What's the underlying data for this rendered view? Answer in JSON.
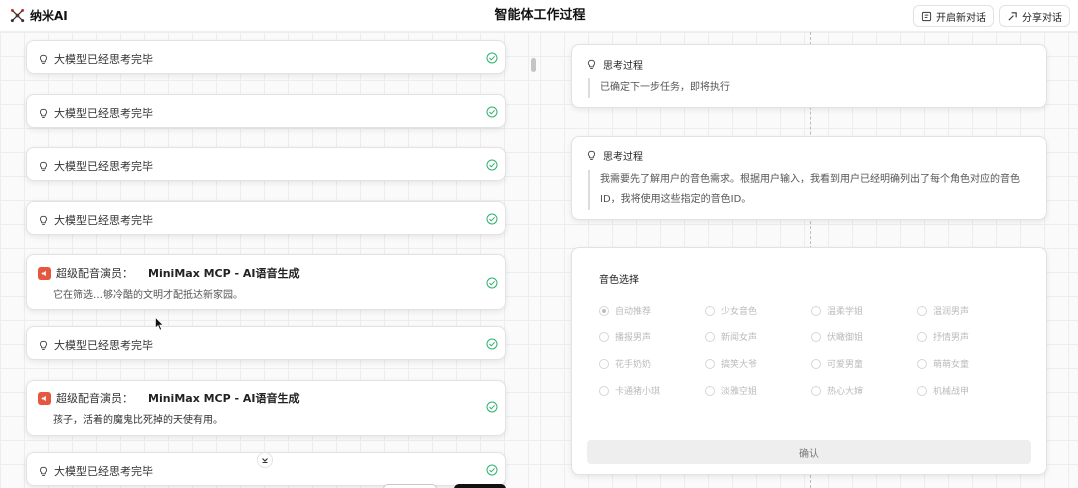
{
  "app": {
    "name": "纳米AI"
  },
  "header": {
    "title": "智能体工作过程",
    "new_chat_label": "开启新对话",
    "share_label": "分享对话"
  },
  "left": {
    "steps": [
      {
        "type": "thought",
        "label": "大模型已经思考完毕"
      },
      {
        "type": "thought",
        "label": "大模型已经思考完毕"
      },
      {
        "type": "thought",
        "label": "大模型已经思考完毕"
      },
      {
        "type": "thought",
        "label": "大模型已经思考完毕"
      },
      {
        "type": "tool",
        "label": "超级配音演员：",
        "tool": "MiniMax MCP - AI语音生成",
        "detail": "它在筛选…够冷酷的文明才配抵达新家园。"
      },
      {
        "type": "thought",
        "label": "大模型已经思考完毕"
      },
      {
        "type": "tool",
        "label": "超级配音演员：",
        "tool": "MiniMax MCP - AI语音生成",
        "detail": "孩子，活着的魔鬼比死掉的天使有用。"
      },
      {
        "type": "thought",
        "label": "大模型已经思考完毕"
      }
    ]
  },
  "right": {
    "thinking1": {
      "title": "思考过程",
      "text": "已确定下一步任务，即将执行"
    },
    "thinking2": {
      "title": "思考过程",
      "text": "我需要先了解用户的音色需求。根据用户输入，我看到用户已经明确列出了每个角色对应的音色ID，我将使用这些指定的音色ID。"
    },
    "voice": {
      "title": "音色选择",
      "selected": "自动推荐",
      "options": [
        "自动推荐",
        "少女音色",
        "温柔学姐",
        "温润男声",
        "播报男声",
        "新闻女声",
        "伏瞰御姐",
        "抒情男声",
        "花手奶奶",
        "搞笑大爷",
        "可爱男童",
        "萌萌女童",
        "卡通猪小琪",
        "淡雅空姐",
        "热心大婶",
        "机械战甲"
      ],
      "confirm_label": "确认"
    }
  },
  "colors": {
    "accent_green": "#2fb26a",
    "badge_red": "#e6573f"
  }
}
